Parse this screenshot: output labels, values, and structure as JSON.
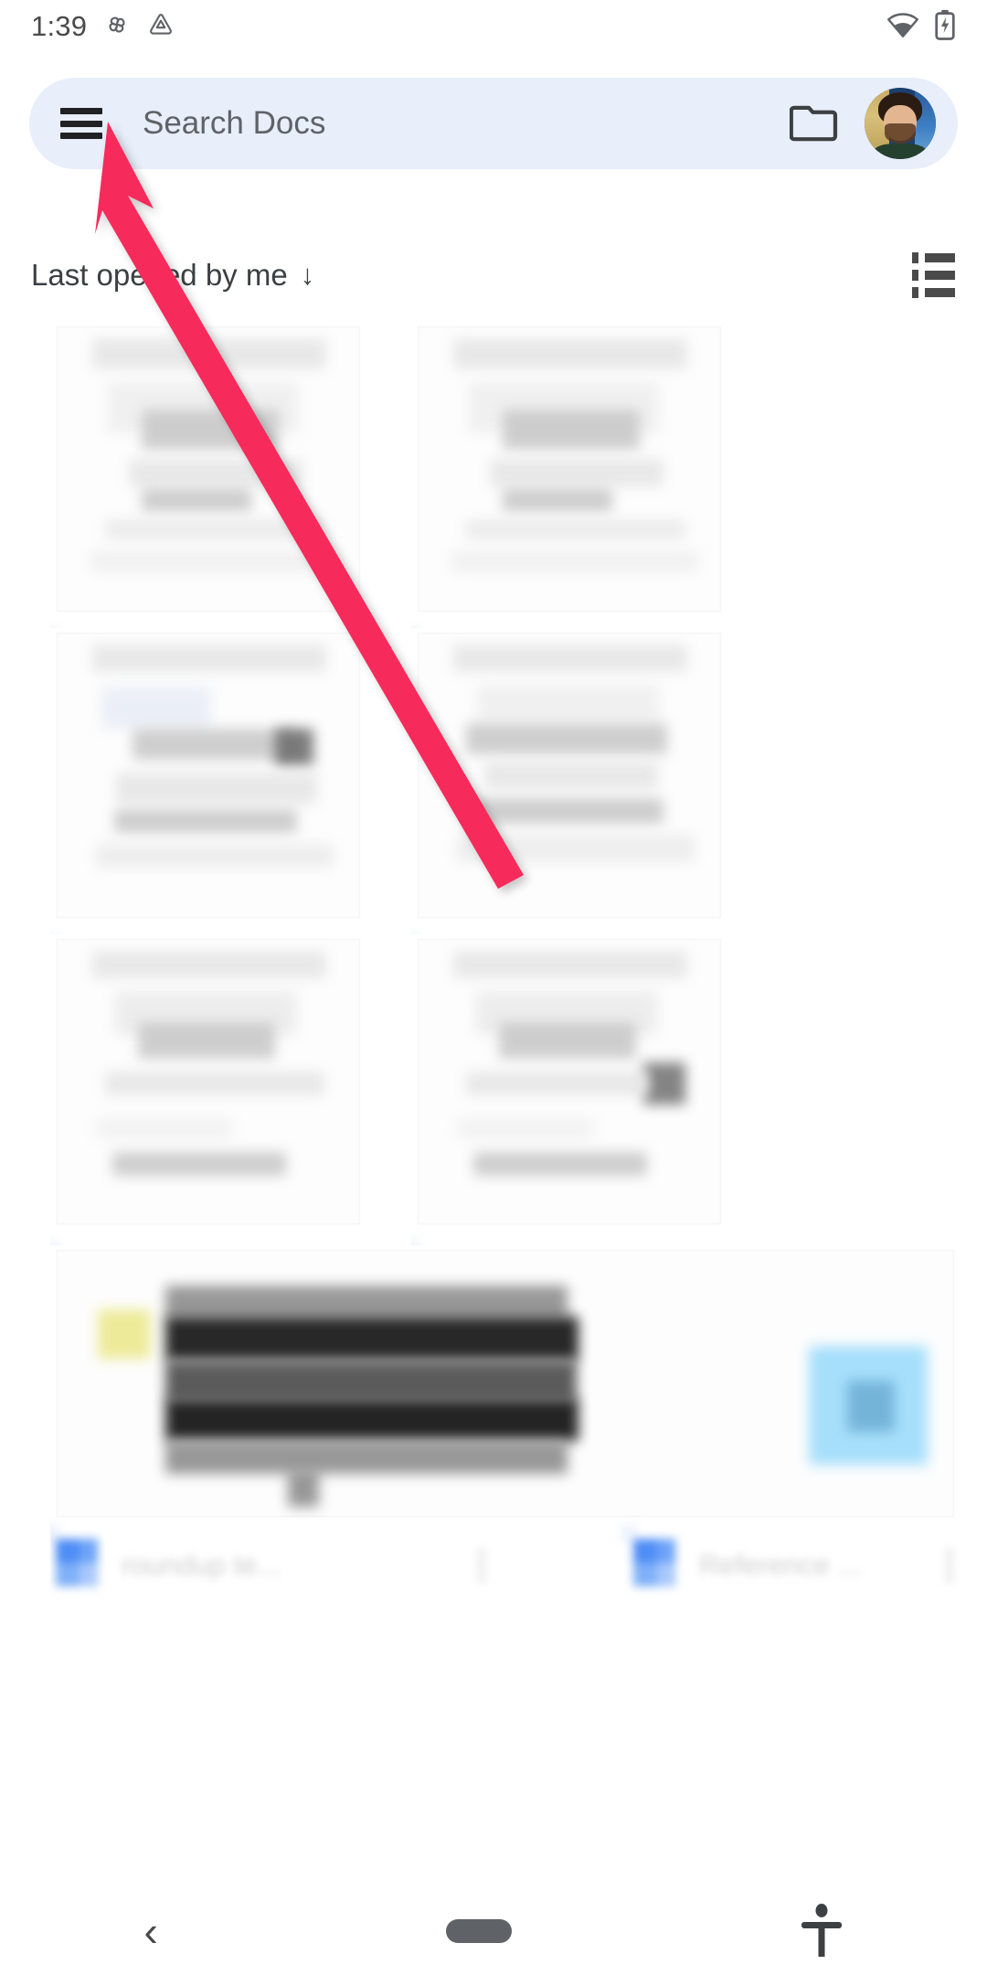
{
  "status_bar": {
    "time": "1:39",
    "left_icons": [
      "pinwheel-icon",
      "drive-triangle-icon"
    ],
    "right_icons": [
      "wifi-icon",
      "battery-charging-icon"
    ]
  },
  "search": {
    "placeholder": "Search Docs",
    "menu_icon": "hamburger-menu-icon",
    "folder_icon": "folder-icon",
    "avatar_icon": "account-avatar"
  },
  "sort": {
    "label": "Last opened by me",
    "direction_arrow": "↓",
    "view_toggle_icon": "list-view-icon"
  },
  "documents": [
    {
      "title": "",
      "icon": "google-docs-icon",
      "more": "more-options-icon"
    },
    {
      "title": "",
      "icon": "google-docs-icon",
      "more": "more-options-icon"
    },
    {
      "title": "",
      "icon": "google-docs-icon",
      "more": "more-options-icon"
    },
    {
      "title": "",
      "icon": "google-docs-icon",
      "more": "more-options-icon"
    },
    {
      "title": "",
      "icon": "google-docs-icon",
      "more": "more-options-icon"
    },
    {
      "title": "",
      "icon": "google-docs-icon",
      "more": "more-options-icon"
    },
    {
      "title": "roundup te...",
      "icon": "google-docs-icon",
      "more": "more-options-icon"
    },
    {
      "title": "Reference ...",
      "icon": "google-docs-icon",
      "more": "more-options-icon"
    }
  ],
  "annotation": {
    "arrow_color": "#F72C5B",
    "points_to": "hamburger-menu-icon"
  },
  "nav_bar": {
    "back_glyph": "‹",
    "home_icon": "home-pill-icon",
    "accessibility_icon": "accessibility-icon"
  },
  "colors": {
    "search_bg": "#E8EEFA",
    "docs_blue": "#4285F4",
    "text_primary": "#3C4043",
    "text_secondary": "#5F6368"
  }
}
